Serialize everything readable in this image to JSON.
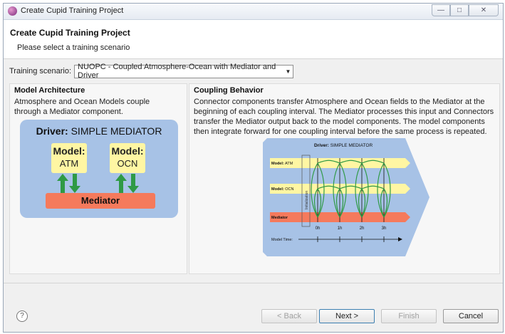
{
  "window": {
    "title": "Create Cupid Training Project"
  },
  "header": {
    "title": "Create Cupid Training Project",
    "subtitle": "Please select a training scenario"
  },
  "scenario": {
    "label": "Training scenario:",
    "selected": "NUOPC - Coupled Atmosphere-Ocean with Mediator and Driver"
  },
  "model_architecture": {
    "title": "Model Architecture",
    "description": "Atmosphere and Ocean Models couple through a Mediator component.",
    "diagram": {
      "driver_prefix": "Driver:",
      "driver_name": "SIMPLE MEDIATOR",
      "model_atm_label": "Model:",
      "model_atm_name": "ATM",
      "model_ocn_label": "Model:",
      "model_ocn_name": "OCN",
      "mediator": "Mediator"
    }
  },
  "coupling_behavior": {
    "title": "Coupling Behavior",
    "description": "Connector components transfer Atmosphere and Ocean fields to the Mediator at the beginning of each coupling interval. The Mediator processes this input and Connectors transfer the Mediator output back to the model components. The model components then integrate forward for one coupling interval before the same process is repeated.",
    "diagram": {
      "driver_prefix": "Driver:",
      "driver_name": "SIMPLE MEDIATOR",
      "row_atm_prefix": "Model:",
      "row_atm_name": "ATM",
      "row_ocn_prefix": "Model:",
      "row_ocn_name": "OCN",
      "row_mediator": "Mediator",
      "initialization": "Initialization",
      "time_labels": [
        "0h",
        "1h",
        "2h",
        "3h"
      ],
      "model_time_label": "Model Time:"
    }
  },
  "footer": {
    "help": "?",
    "back": "< Back",
    "next": "Next >",
    "finish": "Finish",
    "cancel": "Cancel"
  },
  "colors": {
    "diagram_bg": "#a7c2e6",
    "model_box": "#fff6a3",
    "mediator": "#f57a5c",
    "arrow_green": "#2f9a45"
  }
}
